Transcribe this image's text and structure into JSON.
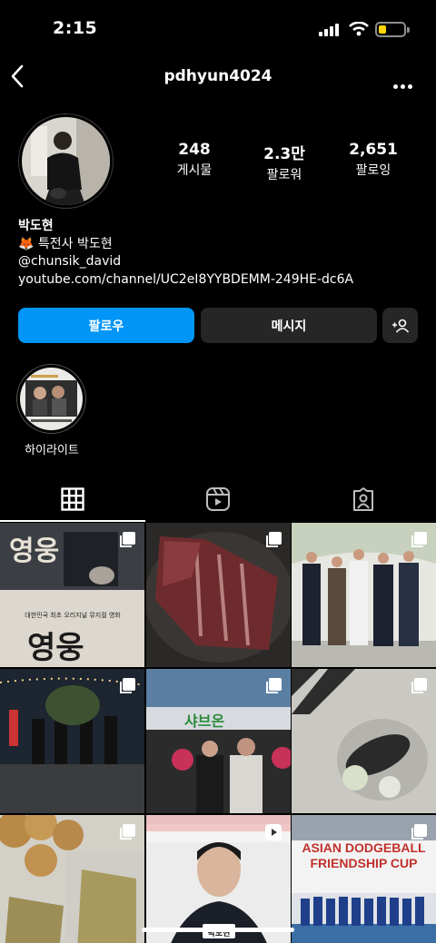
{
  "status_bar": {
    "time": "2:15"
  },
  "header": {
    "username": "pdhyun4024"
  },
  "profile": {
    "stats": [
      {
        "value": "248",
        "label": "게시물"
      },
      {
        "value": "2.3만",
        "label": "팔로워"
      },
      {
        "value": "2,651",
        "label": "팔로잉"
      }
    ],
    "bio": {
      "name": "박도현",
      "line1": "🦊 특전사 박도현",
      "handle": "@chunsik_david",
      "link": "youtube.com/channel/UC2eI8YYBDEMM-249HE-dc6A"
    }
  },
  "buttons": {
    "follow": "팔로우",
    "message": "메시지"
  },
  "highlights": [
    {
      "label": "하이라이트"
    }
  ],
  "tabs": [
    "grid-icon",
    "reels-icon",
    "tagged-icon"
  ],
  "posts": [
    {
      "id": "post-1",
      "overlay_top": "영웅",
      "overlay_sub": "대한민국 최초 오리지널 뮤지컬 영화",
      "overlay_bottom": "영웅"
    },
    {
      "id": "post-2"
    },
    {
      "id": "post-3"
    },
    {
      "id": "post-4"
    },
    {
      "id": "post-5",
      "sign": "샤브온"
    },
    {
      "id": "post-6"
    },
    {
      "id": "post-7"
    },
    {
      "id": "post-8",
      "caption": "박도현"
    },
    {
      "id": "post-9",
      "banner": "ASIAN DODGEBALL FRIENDSHIP CUP"
    }
  ],
  "colors": {
    "accent": "#0095f6",
    "button_dark": "#262626"
  }
}
